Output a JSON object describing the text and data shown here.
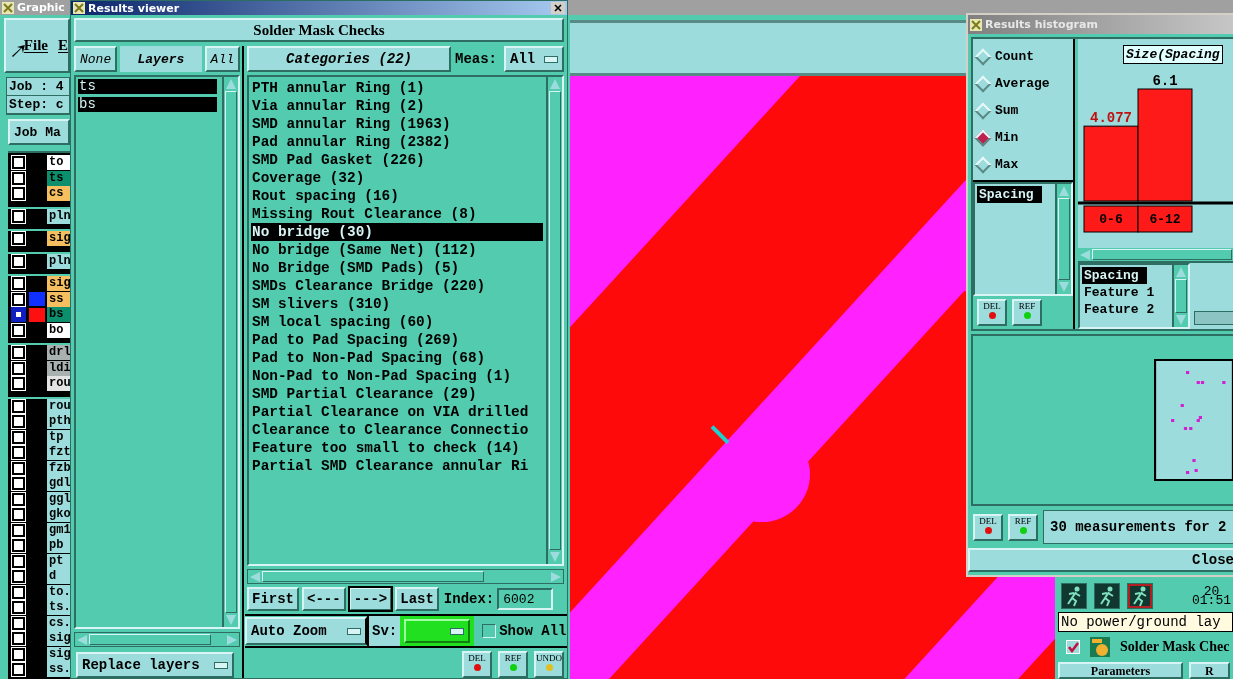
{
  "desktop_window": {
    "title": "Graphic",
    "menu": [
      "File",
      "E"
    ],
    "job": "Job : 4",
    "step": "Step: c",
    "job_button": "Job Ma",
    "layer_groups": [
      [
        {
          "name": "to",
          "color": "#ffffff",
          "selected": false
        },
        {
          "name": "ts",
          "color": "#0c8f6c",
          "selected": false
        },
        {
          "name": "cs",
          "color": "#f5bf5f",
          "selected": false
        }
      ],
      [
        {
          "name": "pln",
          "color": "#9ddcdc",
          "selected": false
        }
      ],
      [
        {
          "name": "sig",
          "color": "#f5bf5f",
          "selected": false
        }
      ],
      [
        {
          "name": "pln",
          "color": "#9ddcdc",
          "selected": false
        }
      ],
      [
        {
          "name": "sig",
          "color": "#f5bf5f",
          "selected": false
        },
        {
          "name": "ss",
          "color": "#f5bf5f",
          "swatch": {
            "color": "#1030ff"
          },
          "selected": false
        },
        {
          "name": "bs",
          "color": "#0c8f6c",
          "swatch": {
            "color": "#ff1010"
          },
          "selected": true
        },
        {
          "name": "bo",
          "color": "#ffffff",
          "selected": false
        }
      ],
      [
        {
          "name": "drl",
          "color": "#a8b0b0",
          "selected": false
        },
        {
          "name": "ldi",
          "color": "#a8b0b0",
          "selected": false
        },
        {
          "name": "rou",
          "color": "#e4e4e4",
          "selected": false
        }
      ],
      [
        {
          "name": "rou",
          "color": "#9ddcdc",
          "selected": false
        },
        {
          "name": "pth",
          "color": "#9ddcdc",
          "selected": false
        },
        {
          "name": "tp",
          "color": "#9ddcdc",
          "selected": false
        },
        {
          "name": "fzt",
          "color": "#9ddcdc",
          "selected": false
        },
        {
          "name": "fzb",
          "color": "#9ddcdc",
          "selected": false
        },
        {
          "name": "gdl",
          "color": "#9ddcdc",
          "selected": false
        },
        {
          "name": "ggl",
          "color": "#9ddcdc",
          "selected": false
        },
        {
          "name": "gko",
          "color": "#9ddcdc",
          "selected": false
        },
        {
          "name": "gm1",
          "color": "#9ddcdc",
          "selected": false
        },
        {
          "name": "pb",
          "color": "#9ddcdc",
          "selected": false
        },
        {
          "name": "pt",
          "color": "#9ddcdc",
          "selected": false
        },
        {
          "name": "d",
          "color": "#9ddcdc",
          "selected": false
        },
        {
          "name": "to.",
          "color": "#9ddcdc",
          "selected": false
        },
        {
          "name": "ts.",
          "color": "#9ddcdc",
          "selected": false
        },
        {
          "name": "cs.",
          "color": "#9ddcdc",
          "selected": false
        },
        {
          "name": "sig",
          "color": "#9ddcdc",
          "selected": false
        },
        {
          "name": "sig",
          "color": "#9ddcdc",
          "selected": false
        },
        {
          "name": "ss.",
          "color": "#9ddcdc",
          "selected": false
        }
      ]
    ]
  },
  "side_panel": {
    "date": "20",
    "time": "01:51",
    "message": "No power/ground lay",
    "action": {
      "label": "Solder Mask Chec",
      "checked": true
    },
    "buttons": [
      "Parameters",
      "R"
    ]
  },
  "results_viewer": {
    "title": "Results viewer",
    "heading": "Solder Mask Checks",
    "layer_buttons": [
      {
        "label": "None",
        "kind": "italic"
      },
      {
        "label": "Layers",
        "kind": "header"
      },
      {
        "label": "All",
        "kind": "italic"
      }
    ],
    "layers": [
      {
        "name": "ts",
        "selected": true
      },
      {
        "name": "bs",
        "selected": true
      }
    ],
    "categories_button": "Categories (22)",
    "meas_label": "Meas:",
    "meas_value": "All",
    "categories": [
      {
        "label": "PTH annular Ring (1)",
        "selected": false
      },
      {
        "label": "Via annular Ring (2)",
        "selected": false
      },
      {
        "label": "SMD annular Ring (1963)",
        "selected": false
      },
      {
        "label": "Pad annular Ring (2382)",
        "selected": false
      },
      {
        "label": "SMD Pad Gasket (226)",
        "selected": false
      },
      {
        "label": "Coverage (32)",
        "selected": false
      },
      {
        "label": "Rout spacing (16)",
        "selected": false
      },
      {
        "label": "Missing Rout Clearance (8)",
        "selected": false
      },
      {
        "label": "No bridge (30)",
        "selected": true
      },
      {
        "label": "No bridge (Same Net) (112)",
        "selected": false
      },
      {
        "label": "No Bridge (SMD Pads) (5)",
        "selected": false
      },
      {
        "label": "SMDs Clearance Bridge (220)",
        "selected": false
      },
      {
        "label": "SM slivers (310)",
        "selected": false
      },
      {
        "label": "SM local spacing (60)",
        "selected": false
      },
      {
        "label": "Pad to Pad Spacing (269)",
        "selected": false
      },
      {
        "label": "Pad to Non-Pad Spacing (68)",
        "selected": false
      },
      {
        "label": "Non-Pad to Non-Pad Spacing (1)",
        "selected": false
      },
      {
        "label": "SMD Partial Clearance (29)",
        "selected": false
      },
      {
        "label": "Partial Clearance on VIA drilled",
        "selected": false
      },
      {
        "label": "Clearance to Clearance Connectio",
        "selected": false
      },
      {
        "label": "Feature too small to check (14)",
        "selected": false
      },
      {
        "label": "Partial SMD Clearance annular Ri",
        "selected": false
      }
    ],
    "nav_buttons": [
      {
        "label": "First",
        "selected": false
      },
      {
        "label": "<---",
        "selected": false
      },
      {
        "label": "--->",
        "selected": true
      },
      {
        "label": "Last",
        "selected": false
      }
    ],
    "index_label": "Index:",
    "index_value": "6002",
    "zoom_mode": "Auto Zoom",
    "sv_label": "Sv:",
    "show_all": {
      "label": "Show All",
      "checked": false
    },
    "layer_action": "Replace layers",
    "tool_buttons": [
      {
        "label": "DEL",
        "kind": "delete"
      },
      {
        "label": "REF",
        "kind": "refresh"
      },
      {
        "label": "UNDO",
        "kind": "undo"
      }
    ]
  },
  "histogram": {
    "title": "Results histogram",
    "modes": [
      {
        "label": "Count",
        "selected": false
      },
      {
        "label": "Average",
        "selected": false
      },
      {
        "label": "Sum",
        "selected": false
      },
      {
        "label": "Min",
        "selected": true
      },
      {
        "label": "Max",
        "selected": false
      }
    ],
    "fields": [
      {
        "label": "Spacing",
        "selected": true
      }
    ],
    "tool_buttons": [
      {
        "label": "DEL",
        "kind": "delete"
      },
      {
        "label": "REF",
        "kind": "refresh"
      }
    ],
    "chart_data": {
      "type": "bar",
      "title": "Size(Spacing",
      "categories": [
        "0-6",
        "6-12"
      ],
      "values": [
        4.077,
        6.1
      ],
      "data_labels": true
    },
    "columns": [
      {
        "label": "Spacing",
        "selected": true
      },
      {
        "label": "Feature 1",
        "selected": false
      },
      {
        "label": "Feature 2",
        "selected": false
      }
    ],
    "footer_buttons": [
      {
        "label": "DEL",
        "kind": "delete"
      },
      {
        "label": "REF",
        "kind": "refresh"
      }
    ],
    "summary": "30 measurements for 2",
    "close": "Close"
  }
}
